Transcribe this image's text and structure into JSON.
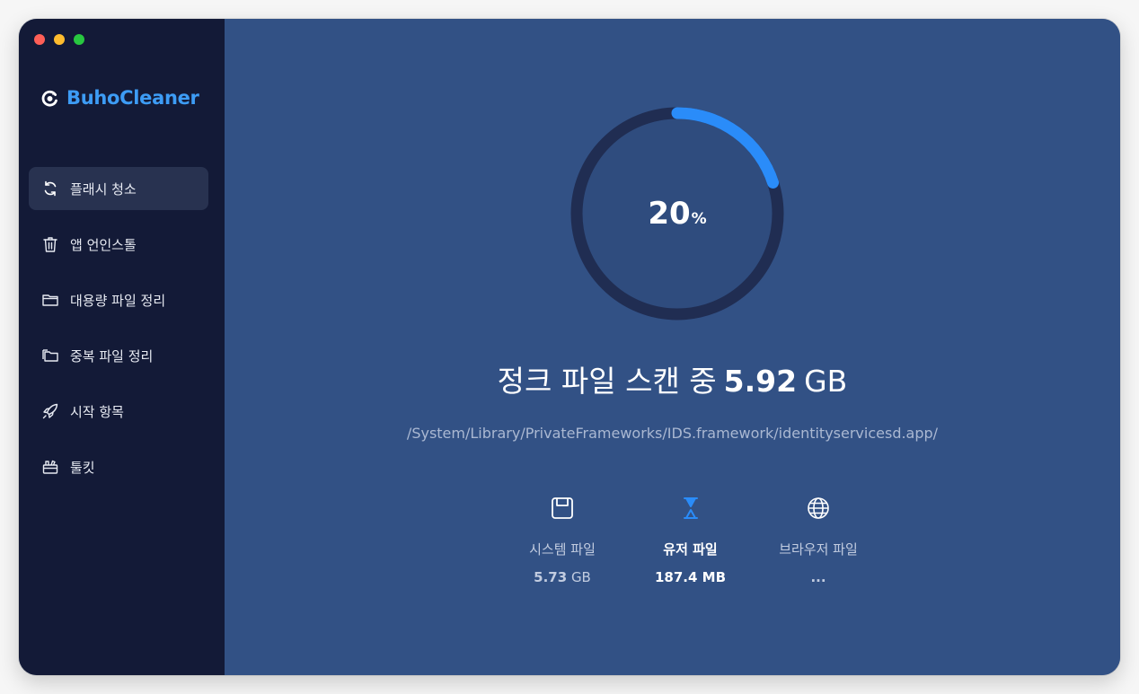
{
  "app": {
    "name": "BuhoCleaner"
  },
  "colors": {
    "accent": "#2a8cf9",
    "sidebar": "#131a37",
    "main": "#325185",
    "brand": "#3d9cf5"
  },
  "sidebar": {
    "items": [
      {
        "label": "플래시 청소",
        "icon": "refresh-icon",
        "active": true
      },
      {
        "label": "앱 언인스톨",
        "icon": "trash-icon",
        "active": false
      },
      {
        "label": "대용량 파일 정리",
        "icon": "folder-icon",
        "active": false
      },
      {
        "label": "중복 파일 정리",
        "icon": "duplicate-folder-icon",
        "active": false
      },
      {
        "label": "시작 항목",
        "icon": "rocket-icon",
        "active": false
      },
      {
        "label": "툴킷",
        "icon": "toolbox-icon",
        "active": false
      }
    ]
  },
  "scan": {
    "progress_value": "20",
    "progress_unit": "%",
    "progress_fraction": 0.2,
    "status_prefix": "정크 파일 스캔 중",
    "total_size": "5.92",
    "total_unit": "GB",
    "current_path": "/System/Library/PrivateFrameworks/IDS.framework/identityservicesd.app/"
  },
  "categories": [
    {
      "label": "시스템 파일",
      "size": "5.73",
      "unit": "GB",
      "icon": "disk-icon",
      "active": false
    },
    {
      "label": "유저 파일",
      "size": "187.4",
      "unit": "MB",
      "icon": "hourglass-icon",
      "active": true
    },
    {
      "label": "브라우저 파일",
      "size": "...",
      "unit": "",
      "icon": "globe-icon",
      "active": false
    }
  ]
}
